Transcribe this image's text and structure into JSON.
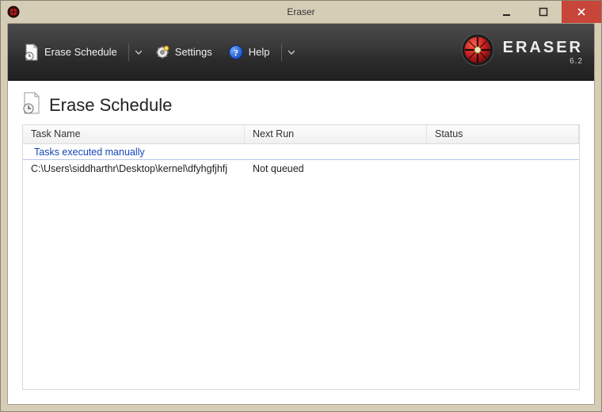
{
  "window": {
    "title": "Eraser"
  },
  "brand": {
    "name": "ERASER",
    "version": "6.2"
  },
  "toolbar": {
    "erase_schedule_label": "Erase Schedule",
    "settings_label": "Settings",
    "help_label": "Help"
  },
  "page": {
    "title": "Erase Schedule"
  },
  "grid": {
    "columns": {
      "task_name": "Task Name",
      "next_run": "Next Run",
      "status": "Status"
    },
    "group_label": "Tasks executed manually",
    "rows": [
      {
        "task_name": "C:\\Users\\siddharthr\\Desktop\\kernel\\dfyhgfjhfj",
        "next_run": "Not queued",
        "status": ""
      }
    ]
  }
}
